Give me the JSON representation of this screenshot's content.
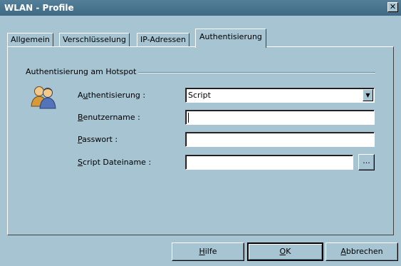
{
  "window": {
    "title": "WLAN - Profile",
    "close_icon": "close-icon"
  },
  "tabs": [
    {
      "label": "Allgemein",
      "active": false
    },
    {
      "label": "Verschlüsselung",
      "active": false
    },
    {
      "label": "IP-Adressen",
      "active": false
    },
    {
      "label": "Authentisierung",
      "active": true
    }
  ],
  "group": {
    "label": "Authentisierung am Hotspot",
    "icon": "users-icon"
  },
  "form": {
    "auth": {
      "label_pre": "A",
      "label_u": "u",
      "label_post": "thentisierung :",
      "value": "Script"
    },
    "user": {
      "label_u": "B",
      "label_post": "enutzername :",
      "value": ""
    },
    "password": {
      "label_u": "P",
      "label_post": "asswort :",
      "value": ""
    },
    "script": {
      "label_u": "S",
      "label_post": "cript Dateiname :",
      "value": "",
      "browse_label": "..."
    }
  },
  "buttons": {
    "help": {
      "u": "H",
      "rest": "ilfe"
    },
    "ok": {
      "u": "O",
      "rest": "K"
    },
    "cancel": {
      "u": "A",
      "rest": "bbrechen"
    }
  }
}
